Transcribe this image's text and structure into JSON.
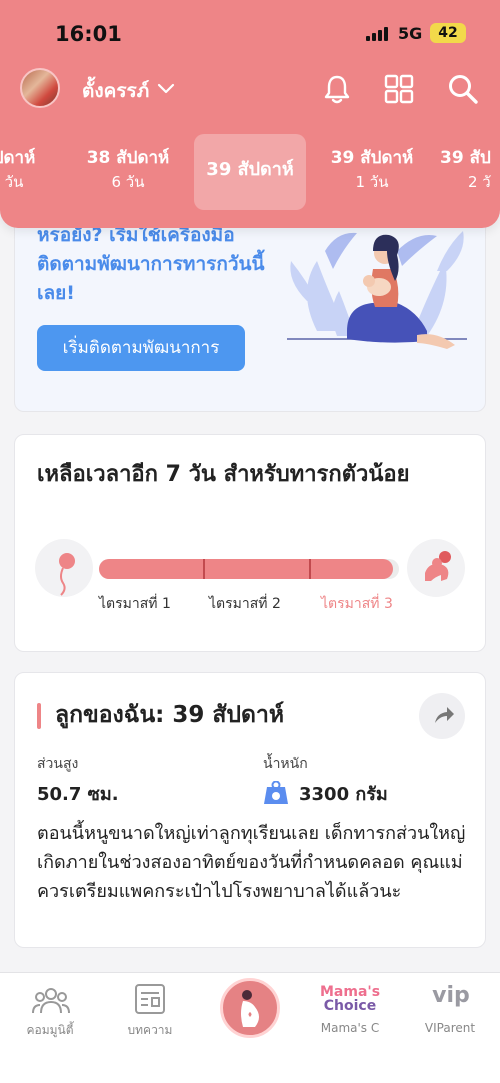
{
  "status_bar": {
    "time": "16:01",
    "network": "5G",
    "battery": "42"
  },
  "header": {
    "profile_name": "ตั้งครรภ์"
  },
  "week_tabs": [
    {
      "main": "ปดาห์",
      "sub": "วัน"
    },
    {
      "main": "38 สัปดาห์",
      "sub": "6 วัน"
    },
    {
      "main": "39 สัปดาห์",
      "sub": ""
    },
    {
      "main": "39 สัปดาห์",
      "sub": "1 วัน"
    },
    {
      "main": "39 สัป",
      "sub": "2 วั"
    }
  ],
  "promo_card": {
    "text": "หรอยัง? เริ่มใช้เครื่องมือติดตามพัฒนาการทารกวันนี้เลย!",
    "button_label": "เริ่มติดตามพัฒนาการ"
  },
  "countdown_card": {
    "title": "เหลือเวลาอีก 7 วัน สำหรับทารกตัวน้อย",
    "progress": 0.98,
    "trimesters": [
      "ไตรมาสที่ 1",
      "ไตรมาสที่ 2",
      "ไตรมาสที่ 3"
    ]
  },
  "baby_card": {
    "title": "ลูกของฉัน: 39 สัปดาห์",
    "height_label": "ส่วนสูง",
    "height_value": "50.7 ซม.",
    "weight_label": "น้ำหนัก",
    "weight_value": "3300 กรัม",
    "description": "ตอนนี้หนูขนาดใหญ่เท่าลูกทุเรียนเลย เด็กทารกส่วนใหญ่เกิดภายในช่วงสองอาทิตย์ของวันที่กำหนดคลอด คุณแม่ควรเตรียมแพคกระเป๋าไปโรงพยาบาลได้แล้วนะ"
  },
  "bottom_nav": {
    "community": "คอมมูนิตี้",
    "articles": "บทความ",
    "mamas_choice_logo_top": "Mama's",
    "mamas_choice_logo_bottom": "Choice",
    "mamas_choice": "Mama's C",
    "vip_logo": "vip",
    "viparent": "VIParent"
  },
  "colors": {
    "brand": "#ee8587",
    "accent_blue": "#4d97f0",
    "text_blue": "#4a8bea"
  }
}
